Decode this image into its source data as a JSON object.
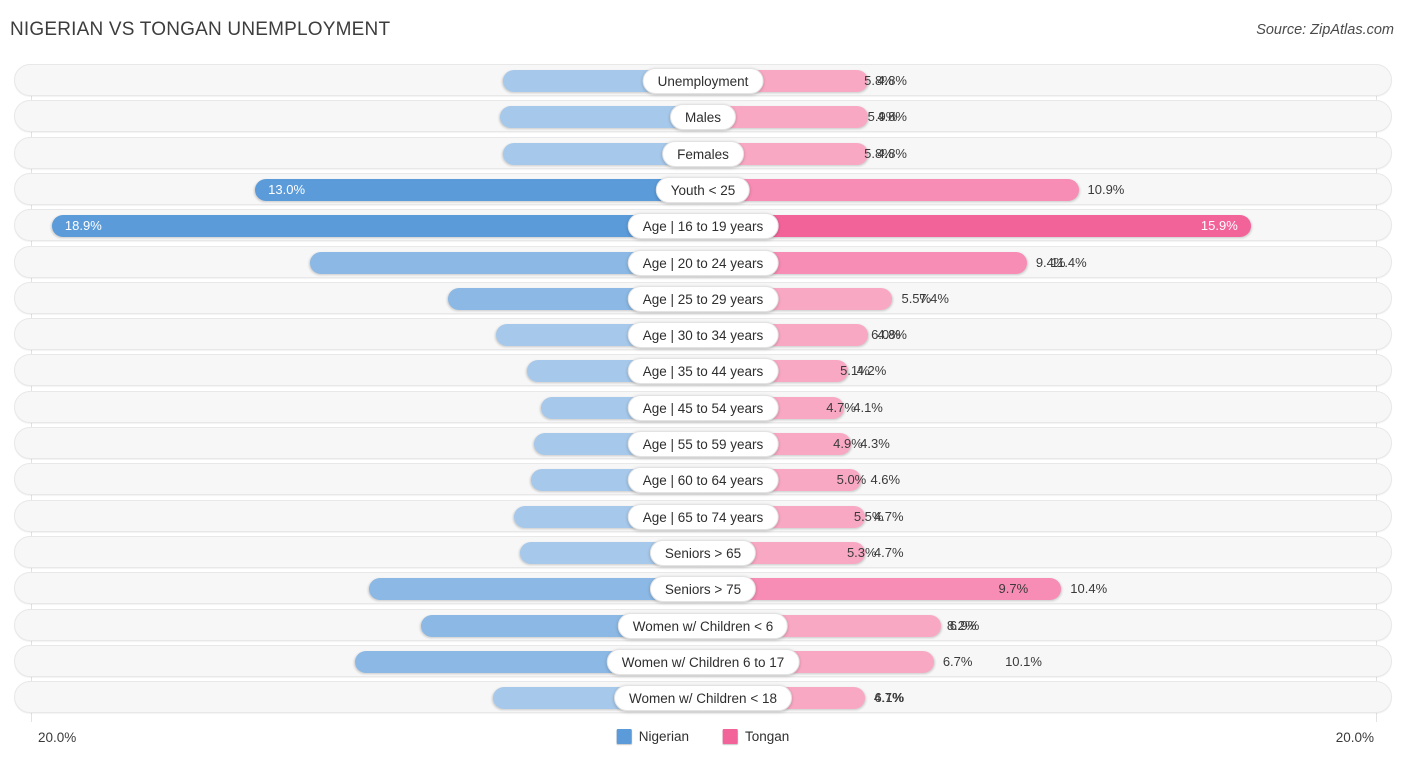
{
  "header": {
    "title": "NIGERIAN VS TONGAN UNEMPLOYMENT",
    "source": "Source: ZipAtlas.com"
  },
  "axis": {
    "left_max_label": "20.0%",
    "right_max_label": "20.0%",
    "max_value": 20.0
  },
  "legend": {
    "items": [
      {
        "label": "Nigerian",
        "color": "#5b9bd9"
      },
      {
        "label": "Tongan",
        "color": "#f2639a"
      }
    ]
  },
  "colors": {
    "left_light": "#a6c8ea",
    "left_mid": "#8bb8e4",
    "left_strong": "#5b9bd9",
    "right_light": "#f9a8c4",
    "right_mid": "#f78cb4",
    "right_strong": "#f2639a",
    "row_bg": "#f7f7f7",
    "row_border": "#e8e8e8"
  },
  "chart_data": {
    "type": "bar",
    "title": "NIGERIAN VS TONGAN UNEMPLOYMENT",
    "subtitle": "",
    "orientation": "horizontal-diverging",
    "xlabel": "",
    "ylabel": "",
    "xlim": [
      20.0,
      20.0
    ],
    "grid": true,
    "legend_position": "bottom-center",
    "categories": [
      "Unemployment",
      "Males",
      "Females",
      "Youth < 25",
      "Age | 16 to 19 years",
      "Age | 20 to 24 years",
      "Age | 25 to 29 years",
      "Age | 30 to 34 years",
      "Age | 35 to 44 years",
      "Age | 45 to 54 years",
      "Age | 55 to 59 years",
      "Age | 60 to 64 years",
      "Age | 65 to 74 years",
      "Seniors > 65",
      "Seniors > 75",
      "Women w/ Children < 6",
      "Women w/ Children 6 to 17",
      "Women w/ Children < 18"
    ],
    "series": [
      {
        "name": "Nigerian",
        "side": "left",
        "values": [
          5.8,
          5.9,
          5.8,
          13.0,
          18.9,
          11.4,
          7.4,
          6.0,
          5.1,
          4.7,
          4.9,
          5.0,
          5.5,
          5.3,
          9.7,
          8.2,
          10.1,
          6.1
        ],
        "labels": [
          "5.8%",
          "5.9%",
          "5.8%",
          "13.0%",
          "18.9%",
          "11.4%",
          "7.4%",
          "6.0%",
          "5.1%",
          "4.7%",
          "4.9%",
          "5.0%",
          "5.5%",
          "5.3%",
          "9.7%",
          "8.2%",
          "10.1%",
          "6.1%"
        ]
      },
      {
        "name": "Tongan",
        "side": "right",
        "values": [
          4.8,
          4.8,
          4.8,
          10.9,
          15.9,
          9.4,
          5.5,
          4.8,
          4.2,
          4.1,
          4.3,
          4.6,
          4.7,
          4.7,
          10.4,
          6.9,
          6.7,
          4.7
        ],
        "labels": [
          "4.8%",
          "4.8%",
          "4.8%",
          "10.9%",
          "15.9%",
          "9.4%",
          "5.5%",
          "4.8%",
          "4.2%",
          "4.1%",
          "4.3%",
          "4.6%",
          "4.7%",
          "4.7%",
          "10.4%",
          "6.9%",
          "6.7%",
          "4.7%"
        ]
      }
    ]
  }
}
